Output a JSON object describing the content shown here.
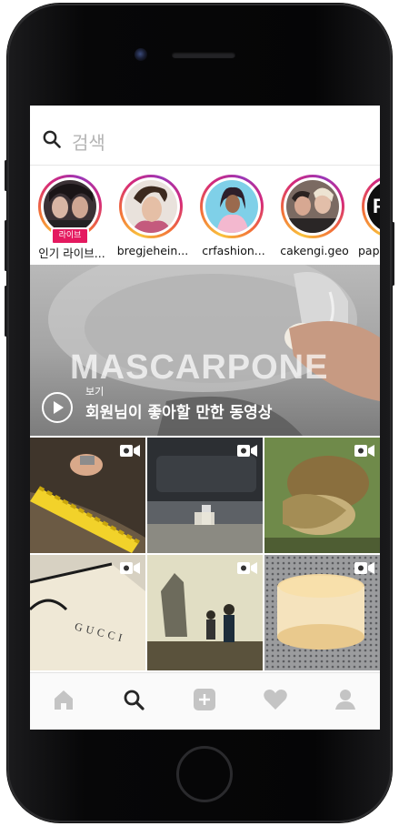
{
  "search": {
    "placeholder": "검색"
  },
  "stories": [
    {
      "username": "인기 라이브...",
      "badge": "라이브"
    },
    {
      "username": "bregjehein..."
    },
    {
      "username": "crfashion..."
    },
    {
      "username": "cakengi.geo"
    },
    {
      "username": "pape"
    }
  ],
  "hero_video": {
    "overlay_text": "MASCARPONE",
    "label": "보기",
    "caption": "회원님이 좋아할 만한 동영상"
  },
  "tabbar": {
    "items": [
      "home-icon",
      "search-icon",
      "add-icon",
      "heart-icon",
      "profile-icon"
    ],
    "active": "search-icon"
  },
  "colors": {
    "live_badge": "#e4195f",
    "story_ring": "#d4287a"
  }
}
